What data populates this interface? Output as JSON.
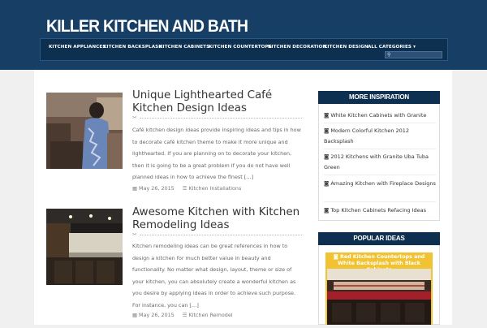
{
  "site": {
    "title": "KILLER KITCHEN AND BATH"
  },
  "nav": {
    "items": [
      "KITCHEN APPLIANCES",
      "KITCHEN BACKSPLASH",
      "KITCHEN CABINETS",
      "KITCHEN COUNTERTOPS",
      "KITCHEN DECORATION",
      "KITCHEN DESIGN",
      "ALL CATEGORIES ▾"
    ],
    "search_icon": "search-icon"
  },
  "posts": [
    {
      "title": "Unique Lighthearted Café Kitchen Design Ideas",
      "excerpt": "Café kitchen design ideas provide inspiring ideas and tips in how to decorate café kitchen theme to make it more unique and lighthearted. If you are planning on to decorate your kitchen, then it is going to be a great problem if you do not have well planned ideas in how to achieve the finest […]",
      "date": "May 26, 2015",
      "category": "Kitchen Installations"
    },
    {
      "title": "Awesome Kitchen with Kitchen Remodeling Ideas",
      "excerpt": "Kitchen remodeling ideas can be great references in how to design a kitchen for much better value in beauty and functionality. No matter what design, layout, theme or size of your kitchen, you can absolutely create a wonderful kitchen as you desire by applying ideas in order to achieve such purpose. For instance, you can […]",
      "date": "May 26, 2015",
      "category": "Kitchen Remodel"
    }
  ],
  "sidebar": {
    "more_title": "MORE INSPIRATION",
    "more_items": [
      "White Kitchen Cabinets with Granite",
      "Modern Colorful Kitchen 2012 Backsplash",
      "2012 Kitchens with Granite Uba Tuba Green",
      "Amazing Kitchen with Fireplace Designs",
      "Top Kitchen Cabinets Refacing Ideas"
    ],
    "popular_title": "POPULAR IDEAS",
    "popular_caption": "Red Kitchen Countertops and White Backsplash with Black Cabinets"
  },
  "colors": {
    "header_bg": "#173f66",
    "nav_bg": "#0d2f50",
    "widget_title_bg": "#0d2f50",
    "popular_card": "#f1c232"
  }
}
